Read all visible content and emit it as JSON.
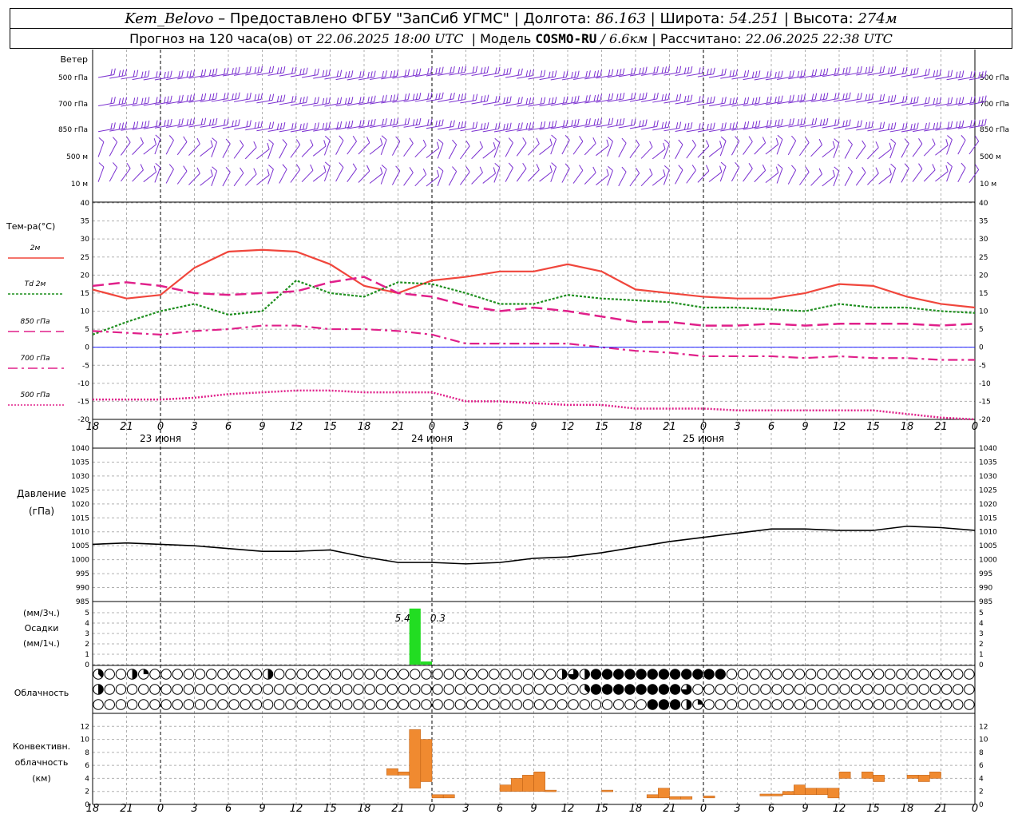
{
  "header": {
    "station": "Kem_Belovo",
    "dash": "–",
    "provider": "Предоставлено ФГБУ \"ЗапСиб УГМС\"",
    "lon_label": "Долгота:",
    "lon": "86.163",
    "lat_label": "Широта:",
    "lat": "54.251",
    "alt_label": "Высота:",
    "alt": "274м",
    "forecast_label": "Прогноз на 120 часа(ов) от",
    "forecast_start": "22.06.2025 18:00 UTC",
    "model_label": "Модель",
    "model": "COSMO-RU",
    "resolution": "/ 6.6км",
    "calc_label": "Рассчитано:",
    "calc_time": "22.06.2025 22:38 UTC"
  },
  "colors": {
    "wind": "#7a2fd0",
    "t2m": "#f0463c",
    "td2m": "#1f8f1f",
    "t850": "#e0208a",
    "t700": "#e0208a",
    "t500": "#e0208a",
    "zero_line": "#2020ff",
    "pressure": "#000000",
    "precip": "#22dd22",
    "convective": "#f08a30",
    "grid": "#aaaaaa"
  },
  "chart_data": [
    {
      "type": "wind-barbs",
      "title": "Ветер",
      "levels": [
        "500 гПа",
        "700 гПа",
        "850 гПа",
        "500 м",
        "10  м"
      ],
      "icon": "wind-barb-icon"
    },
    {
      "type": "line",
      "ylabel": "Тем-ра(°C)",
      "ylim": [
        -20,
        40
      ],
      "yticks": [
        -20,
        -15,
        -10,
        -5,
        0,
        5,
        10,
        15,
        20,
        25,
        30,
        35,
        40
      ],
      "x_hours": [
        0,
        3,
        6,
        9,
        12,
        15,
        18,
        21,
        24,
        27,
        30,
        33,
        36,
        39,
        42,
        45,
        48,
        51,
        54,
        57,
        60,
        63,
        66,
        69,
        72,
        75,
        78
      ],
      "series": [
        {
          "name": "2м",
          "style": "solid",
          "values": [
            16,
            13.5,
            14.5,
            22,
            26.5,
            27,
            26.5,
            23,
            17,
            15,
            18.5,
            19.5,
            21,
            21,
            23,
            21,
            16,
            15,
            14,
            13.5,
            13.5,
            15,
            17.5,
            17,
            14,
            12,
            11
          ]
        },
        {
          "name": "Td  2м",
          "style": "dotted",
          "values": [
            3.5,
            7,
            10,
            12,
            9,
            10,
            18.5,
            15,
            14,
            18,
            17.5,
            15,
            12,
            12,
            14.5,
            13.5,
            13,
            12.5,
            11,
            11,
            10.5,
            10,
            12,
            11,
            11,
            10,
            9.5
          ]
        },
        {
          "name": "850 гПа",
          "style": "dashed",
          "values": [
            17,
            18,
            17,
            15,
            14.5,
            15,
            15.5,
            18,
            19.5,
            15,
            14,
            11.5,
            10,
            11,
            10,
            8.5,
            7,
            7,
            6,
            6,
            6.5,
            6,
            6.5,
            6.5,
            6.5,
            6,
            6.5
          ]
        },
        {
          "name": "700 гПа",
          "style": "dashdot",
          "values": [
            4.5,
            4,
            3.5,
            4.5,
            5,
            6,
            6,
            5,
            5,
            4.5,
            3.5,
            1,
            1,
            1,
            1,
            0,
            -1,
            -1.5,
            -2.5,
            -2.5,
            -2.5,
            -3,
            -2.5,
            -3,
            -3,
            -3.5,
            -3.5
          ]
        },
        {
          "name": "500 гПа",
          "style": "fine-dotted",
          "values": [
            -14.5,
            -14.5,
            -14.5,
            -14,
            -13,
            -12.5,
            -12,
            -12,
            -12.5,
            -12.5,
            -12.5,
            -15,
            -15,
            -15.5,
            -16,
            -16,
            -17,
            -17,
            -17,
            -17.5,
            -17.5,
            -17.5,
            -17.5,
            -17.5,
            -18.5,
            -19.5,
            -20
          ]
        }
      ]
    },
    {
      "type": "line",
      "ylabel": "Давление",
      "yunit": "(гПа)",
      "ylim": [
        985,
        1040
      ],
      "yticks": [
        985,
        990,
        995,
        1000,
        1005,
        1010,
        1015,
        1020,
        1025,
        1030,
        1035,
        1040
      ],
      "x_hours": [
        0,
        3,
        6,
        9,
        12,
        15,
        18,
        21,
        24,
        27,
        30,
        33,
        36,
        39,
        42,
        45,
        48,
        51,
        54,
        57,
        60,
        63,
        66,
        69,
        72,
        75,
        78
      ],
      "series": [
        {
          "name": "Давление",
          "values": [
            1005.5,
            1006,
            1005.5,
            1005,
            1004,
            1003,
            1003,
            1003.5,
            1001,
            999,
            999,
            998.5,
            999,
            1000.5,
            1001,
            1002.5,
            1004.5,
            1006.5,
            1008,
            1009.5,
            1011,
            1011,
            1010.5,
            1010.5,
            1012,
            1011.5,
            1010.5
          ]
        }
      ]
    },
    {
      "type": "bar",
      "ylabel_top": "(мм/3ч.)",
      "ylabel_mid": "Осадки",
      "ylabel_bottom": "(мм/1ч.)",
      "ylim": [
        0,
        6
      ],
      "yticks": [
        0,
        1,
        2,
        3,
        4,
        5
      ],
      "bars": [
        {
          "hour": 28,
          "value": 5.4,
          "label": "5.4"
        },
        {
          "hour": 29,
          "value": 0.3,
          "label": "0.3"
        }
      ]
    },
    {
      "type": "table",
      "title": "Облачность",
      "note": "cloud cover octas per 1h step, rows top to bottom",
      "rows": [
        [
          3,
          8,
          0,
          0,
          0,
          4,
          2,
          0,
          0,
          0,
          0,
          0,
          0,
          0,
          0,
          0,
          0,
          0,
          0,
          0,
          0,
          0,
          0,
          0,
          4,
          0,
          0,
          0,
          0,
          0,
          0,
          0,
          0,
          0,
          0,
          0,
          0,
          0,
          0,
          0,
          0,
          0,
          0,
          0,
          0,
          0,
          0,
          0,
          0,
          0,
          0,
          0,
          0,
          0,
          0,
          0,
          0,
          0,
          0,
          0,
          0,
          0,
          0,
          0,
          0,
          4,
          3,
          6,
          4,
          8,
          8,
          8,
          8,
          8,
          8,
          8,
          8,
          8,
          8,
          8,
          8,
          8,
          8,
          8,
          8,
          8,
          8,
          8,
          0,
          0,
          0,
          0,
          0,
          0,
          0,
          0,
          0,
          0,
          0,
          0,
          0,
          0,
          0,
          0,
          0,
          0,
          0,
          0,
          0,
          0,
          0,
          0,
          0,
          0,
          0,
          0,
          0,
          0,
          0,
          0,
          0,
          0,
          0,
          0
        ],
        [
          4,
          0,
          0,
          0,
          0,
          0,
          0,
          0,
          0,
          0,
          0,
          0,
          0,
          0,
          0,
          0,
          0,
          0,
          0,
          0,
          0,
          0,
          0,
          0,
          0,
          0,
          0,
          0,
          0,
          0,
          0,
          0,
          0,
          0,
          0,
          0,
          0,
          0,
          0,
          0,
          0,
          0,
          0,
          0,
          0,
          0,
          0,
          0,
          0,
          0,
          0,
          0,
          0,
          0,
          0,
          0,
          0,
          0,
          0,
          0,
          0,
          0,
          0,
          0,
          0,
          0,
          3,
          6,
          8,
          8,
          8,
          8,
          8,
          8,
          8,
          8,
          8,
          8,
          8,
          8,
          6,
          0,
          0,
          0,
          0,
          0,
          0,
          0,
          0,
          0,
          0,
          0,
          0,
          0,
          0,
          0,
          0,
          0,
          0,
          0,
          0,
          0,
          0,
          0,
          0,
          0,
          0,
          0,
          0,
          0,
          0,
          0,
          0,
          0,
          0,
          0,
          0,
          0,
          0,
          0
        ],
        [
          0,
          0,
          0,
          0,
          0,
          0,
          0,
          0,
          0,
          0,
          0,
          0,
          0,
          0,
          0,
          0,
          0,
          0,
          0,
          0,
          0,
          0,
          0,
          0,
          0,
          0,
          0,
          0,
          0,
          0,
          0,
          0,
          0,
          0,
          0,
          0,
          0,
          0,
          0,
          0,
          0,
          0,
          0,
          0,
          0,
          0,
          0,
          0,
          0,
          0,
          0,
          0,
          0,
          0,
          0,
          0,
          0,
          0,
          0,
          0,
          0,
          0,
          0,
          0,
          0,
          0,
          0,
          0,
          0,
          0,
          0,
          0,
          0,
          0,
          0,
          0,
          0,
          0,
          8,
          8,
          8,
          8,
          8,
          4,
          2,
          0,
          0,
          0,
          0,
          0,
          0,
          0,
          0,
          0,
          0,
          0,
          0,
          0,
          0,
          0,
          0,
          0,
          0,
          0,
          0,
          0,
          0,
          0,
          0,
          0,
          0,
          0,
          0,
          0,
          0,
          0,
          0,
          0,
          0,
          0,
          0,
          0,
          0,
          0
        ]
      ]
    },
    {
      "type": "bar",
      "ylabel": "Конвективн.",
      "ylabel2": "облачность",
      "yunit": "(км)",
      "ylim": [
        0,
        14
      ],
      "yticks": [
        0,
        2,
        4,
        6,
        8,
        10,
        12
      ],
      "bars": [
        {
          "hour": 26,
          "bottom": 4.5,
          "top": 5.5
        },
        {
          "hour": 27,
          "bottom": 4.5,
          "top": 5
        },
        {
          "hour": 28,
          "bottom": 2.5,
          "top": 11.5
        },
        {
          "hour": 29,
          "bottom": 3.5,
          "top": 10
        },
        {
          "hour": 30,
          "bottom": 1,
          "top": 1.5
        },
        {
          "hour": 31,
          "bottom": 1,
          "top": 1.5
        },
        {
          "hour": 36,
          "bottom": 2,
          "top": 3
        },
        {
          "hour": 37,
          "bottom": 2,
          "top": 4
        },
        {
          "hour": 38,
          "bottom": 2,
          "top": 4.5
        },
        {
          "hour": 39,
          "bottom": 2,
          "top": 5
        },
        {
          "hour": 40,
          "bottom": 2,
          "top": 2.2
        },
        {
          "hour": 45,
          "bottom": 2,
          "top": 2.2
        },
        {
          "hour": 49,
          "bottom": 1,
          "top": 1.5
        },
        {
          "hour": 50,
          "bottom": 1,
          "top": 2.5
        },
        {
          "hour": 51,
          "bottom": 0.8,
          "top": 1.2
        },
        {
          "hour": 52,
          "bottom": 0.8,
          "top": 1.2
        },
        {
          "hour": 54,
          "bottom": 1,
          "top": 1.3
        },
        {
          "hour": 59,
          "bottom": 1.3,
          "top": 1.6
        },
        {
          "hour": 60,
          "bottom": 1.3,
          "top": 1.6
        },
        {
          "hour": 61,
          "bottom": 1.5,
          "top": 2
        },
        {
          "hour": 62,
          "bottom": 1.5,
          "top": 3
        },
        {
          "hour": 63,
          "bottom": 1.5,
          "top": 2.5
        },
        {
          "hour": 64,
          "bottom": 1.5,
          "top": 2.5
        },
        {
          "hour": 65,
          "bottom": 1,
          "top": 2.5
        },
        {
          "hour": 66,
          "bottom": 4,
          "top": 5
        },
        {
          "hour": 68,
          "bottom": 4,
          "top": 5
        },
        {
          "hour": 69,
          "bottom": 3.5,
          "top": 4.5
        },
        {
          "hour": 72,
          "bottom": 4,
          "top": 4.5
        },
        {
          "hour": 73,
          "bottom": 3.5,
          "top": 4.5
        },
        {
          "hour": 74,
          "bottom": 4,
          "top": 5
        }
      ]
    }
  ],
  "time_axis": {
    "tick_hours": [
      0,
      3,
      6,
      9,
      12,
      15,
      18,
      21,
      24,
      27,
      30,
      33,
      36,
      39,
      42,
      45,
      48,
      51,
      54,
      57,
      60,
      63,
      66,
      69,
      72,
      75,
      78
    ],
    "tick_labels": [
      "18",
      "21",
      "0",
      "3",
      "6",
      "9",
      "12",
      "15",
      "18",
      "21",
      "0",
      "3",
      "6",
      "9",
      "12",
      "15",
      "18",
      "21",
      "0",
      "3",
      "6",
      "9",
      "12",
      "15",
      "18",
      "21",
      "0"
    ],
    "day_hours": [
      6,
      30,
      54
    ],
    "day_labels": [
      "23 июня",
      "24 июня",
      "25 июня"
    ]
  }
}
